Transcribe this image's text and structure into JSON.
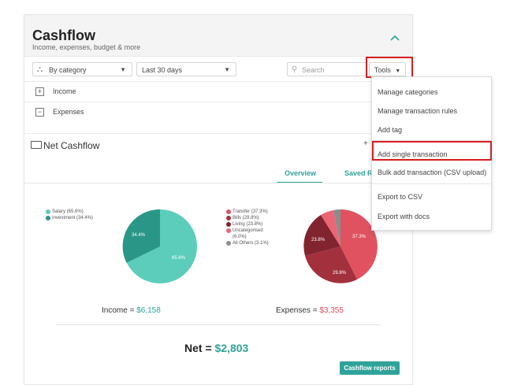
{
  "card": {
    "title": "Cashflow",
    "subtitle": "Income, expenses, budget & more"
  },
  "toolbar": {
    "group_by": "By category",
    "date_range": "Last 30 days",
    "search_placeholder": "Search",
    "tools_label": "Tools"
  },
  "rows": {
    "income_label": "Income",
    "expenses_label": "Expenses"
  },
  "net_cashflow": {
    "label": "Net Cashflow",
    "add_symbol": "+"
  },
  "tabs": {
    "overview": "Overview",
    "saved": "Saved R"
  },
  "income_chart": {
    "legend": [
      {
        "label": "Salary (65.6%)",
        "color": "#5ccdbb"
      },
      {
        "label": "Investment (34.4%)",
        "color": "#2a9688"
      }
    ],
    "slice_labels": [
      "34.4%",
      "65.6%"
    ],
    "total_label": "Income = ",
    "total_value": "$6,158"
  },
  "expenses_chart": {
    "legend": [
      {
        "label": "Transfer (37.3%)",
        "color": "#e05260"
      },
      {
        "label": "Bills (29.8%)",
        "color": "#a3303d"
      },
      {
        "label": "Living (23.8%)",
        "color": "#82242f"
      },
      {
        "label": "Uncategorised",
        "color": "#ea6674"
      },
      {
        "label": "(6.0%)",
        "color": "transparent"
      },
      {
        "label": "All Others (3.1%)",
        "color": "#8c8c8c"
      }
    ],
    "slice_labels": [
      "23.8%",
      "37.3%",
      "29.8%"
    ],
    "total_label": "Expenses = ",
    "total_value": "$3,355"
  },
  "net": {
    "label": "Net = ",
    "value": "$2,803"
  },
  "reports_button": "Cashflow reports",
  "tools_menu": {
    "items": [
      "Manage categories",
      "Manage transaction rules",
      "Add tag",
      "Add single transaction",
      "Bulk add transaction (CSV upload)",
      "Export to CSV",
      "Export with docs"
    ]
  },
  "colors": {
    "accent": "#2fa39a",
    "highlight": "#d81e1e",
    "expense_value": "#d94b57"
  }
}
